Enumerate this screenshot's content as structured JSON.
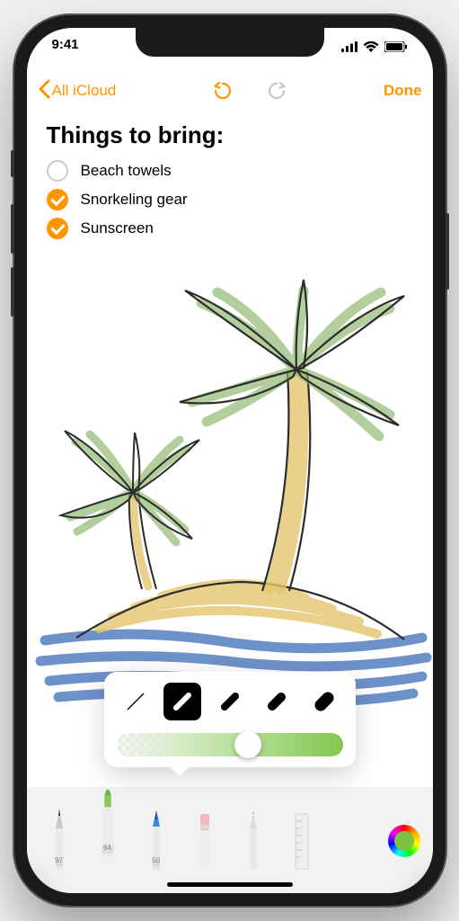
{
  "status": {
    "time": "9:41"
  },
  "nav": {
    "back": "All iCloud",
    "done": "Done"
  },
  "note": {
    "title": "Things to bring:",
    "items": [
      {
        "label": "Beach towels",
        "checked": false
      },
      {
        "label": "Snorkeling gear",
        "checked": true
      },
      {
        "label": "Sunscreen",
        "checked": true
      }
    ]
  },
  "tools": {
    "items": [
      {
        "name": "pen",
        "num": "97"
      },
      {
        "name": "marker",
        "num": "64"
      },
      {
        "name": "pencil",
        "num": "50"
      },
      {
        "name": "eraser",
        "num": ""
      },
      {
        "name": "lasso",
        "num": ""
      },
      {
        "name": "ruler",
        "num": ""
      }
    ],
    "active_index": 1,
    "selected_color": "#7cc244"
  },
  "tip_popup": {
    "selected_index": 1,
    "opacity": 0.58
  }
}
